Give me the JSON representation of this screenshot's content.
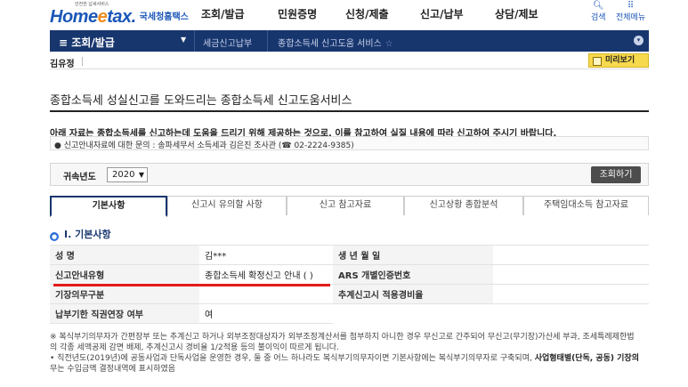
{
  "header": {
    "logo_small": "안전한 납세서비스",
    "logo_main": "Home",
    "logo_e": "e",
    "logo_tail": "tax.",
    "logo_ko": "국세청홈택스",
    "menu": [
      "조회/발급",
      "민원증명",
      "신청/제출",
      "신고/납부",
      "상담/제보"
    ],
    "search_label": "검색",
    "allmenu_label": "전체메뉴"
  },
  "nav": {
    "current": "≡  조회/발급",
    "crumbs": [
      "세금신고납부",
      "종합소득세 신고도움 서비스"
    ]
  },
  "user": {
    "name": "김유정"
  },
  "preview_label": "미리보기",
  "title": "종합소득세 성실신고를 도와드리는 종합소득세 신고도움서비스",
  "notice": "아래 자료는 종합소득세를 신고하는데 도움을 드리기 위해 제공하는 것으로, 이를 참고하여 실질 내용에 따라 신고하여 주시기 바랍니다.",
  "inquiry": "● 신고안내자료에 대한 문의 : 송파세무서 소득세과 김은진 조사관 (☎ 02-2224-9385)",
  "year": {
    "label": "귀속년도",
    "value": "2020",
    "button": "조회하기"
  },
  "tabs": [
    "기본사항",
    "신고시 유의할 사항",
    "신고 참고자료",
    "신고상황 종합분석",
    "주택임대소득 참고자료"
  ],
  "section": {
    "num": "I",
    "title": "Ⅰ. 기본사항"
  },
  "table": {
    "rows": [
      [
        "성          명",
        "김***",
        "생  년  월  일",
        ""
      ],
      [
        "신고안내유형",
        "종합소득세 확정신고 안내 (      )",
        "ARS 개별인증번호",
        ""
      ],
      [
        "기장의무구분",
        "",
        "추계신고시 적용경비율",
        ""
      ],
      [
        "납부기한 직권연장 여부",
        "여",
        "",
        ""
      ]
    ]
  },
  "footnotes": [
    "※ 복식부기의무자가 간편장부 또는 추계신고 하거나 외부조정대상자가 외부조정계산서를 첨부하지 아니한 경우 무신고로 간주되어 무신고(무기장)가산세 부과, 조세특례제한법",
    "의 각종 세액공제 감면 배제, 추계신고시 경비율 1/2적용 등의 불이익이 따르게 됩니다.",
    "• 직전년도(2019년)에 공동사업과 단독사업을 운영한 경우, 둘 중 어느 하나라도 복식부기의무자이면 기본사항에는 복식부기의무자로 구축되며, ",
    "사업형태별(단독, 공동) 기장의",
    "무는 수입금액 결정내역에 표시하였음"
  ]
}
